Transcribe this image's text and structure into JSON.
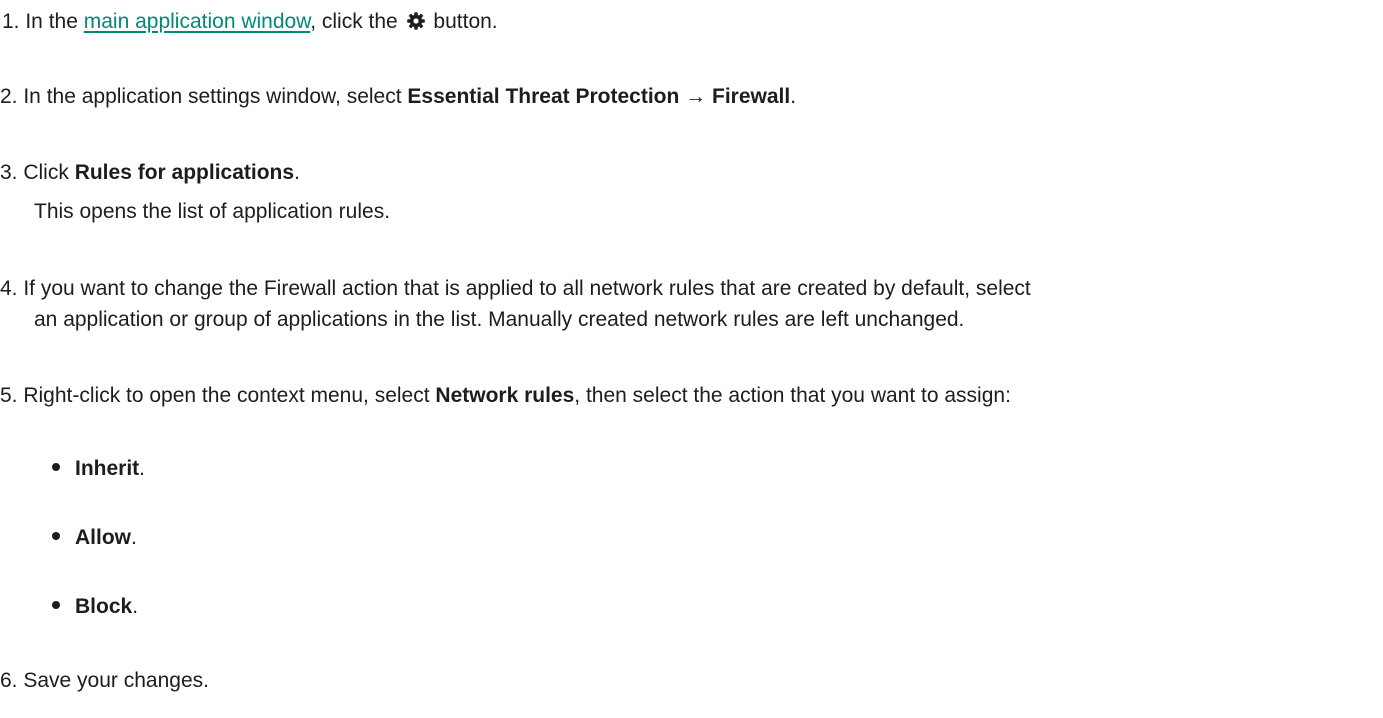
{
  "steps": [
    {
      "number": "1.",
      "text_before": " In the ",
      "link": "main application window",
      "text_middle": ", click the ",
      "icon": "gear-icon",
      "text_after": " button."
    },
    {
      "number": "2.",
      "text_before": " In the application settings window, select ",
      "bold1": "Essential Threat Protection",
      "arrow": " → ",
      "bold2": "Firewall",
      "text_after": "."
    },
    {
      "number": "3.",
      "text_before": " Click ",
      "bold": "Rules for applications",
      "text_after": ".",
      "note": "This opens the list of application rules."
    },
    {
      "number": "4.",
      "line1": " If you want to change the Firewall action that is applied to all network rules that are created by default, select",
      "line2": "an application or group of applications in the list. Manually created network rules are left unchanged."
    },
    {
      "number": "5.",
      "text_before": " Right-click to open the context menu, select ",
      "bold": "Network rules",
      "text_after": ", then select the action that you want to assign:",
      "options": [
        {
          "label": "Inherit",
          "suffix": "."
        },
        {
          "label": "Allow",
          "suffix": "."
        },
        {
          "label": "Block",
          "suffix": "."
        }
      ]
    },
    {
      "number": "6.",
      "text": " Save your changes."
    }
  ],
  "colors": {
    "text": "#1d1d1b",
    "link": "#008a73"
  }
}
